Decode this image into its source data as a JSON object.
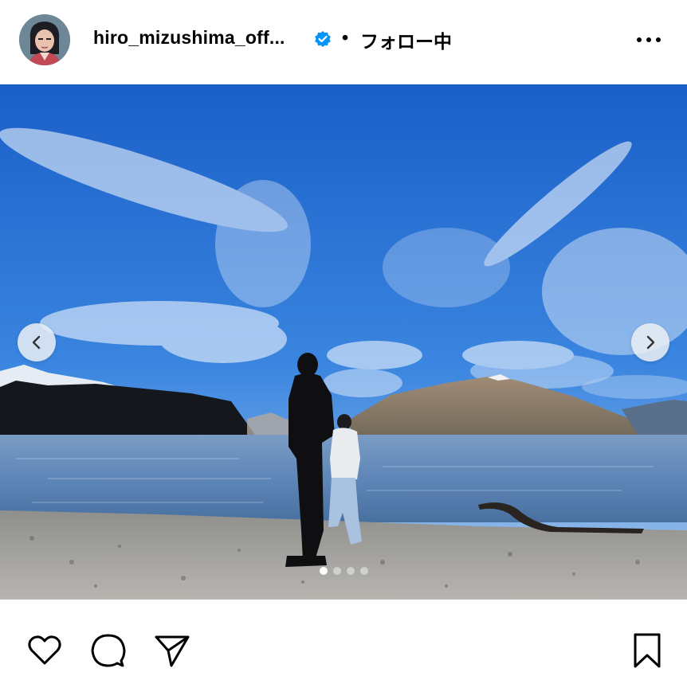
{
  "post": {
    "username": "hiro_mizushima_off...",
    "separator": "•",
    "follow_status": "フォロー中",
    "verified": true
  },
  "icons": {
    "verified": "verified-badge-icon",
    "more": "more-options-icon",
    "prev": "chevron-left-icon",
    "next": "chevron-right-icon",
    "like": "heart-icon",
    "comment": "comment-icon",
    "share": "send-icon",
    "save": "bookmark-icon"
  },
  "carousel": {
    "total_slides": 4,
    "active_slide": 1
  },
  "colors": {
    "verified": "#0095f6",
    "sky_top": "#1a5fc8",
    "sky_bottom": "#6ea4e3"
  }
}
